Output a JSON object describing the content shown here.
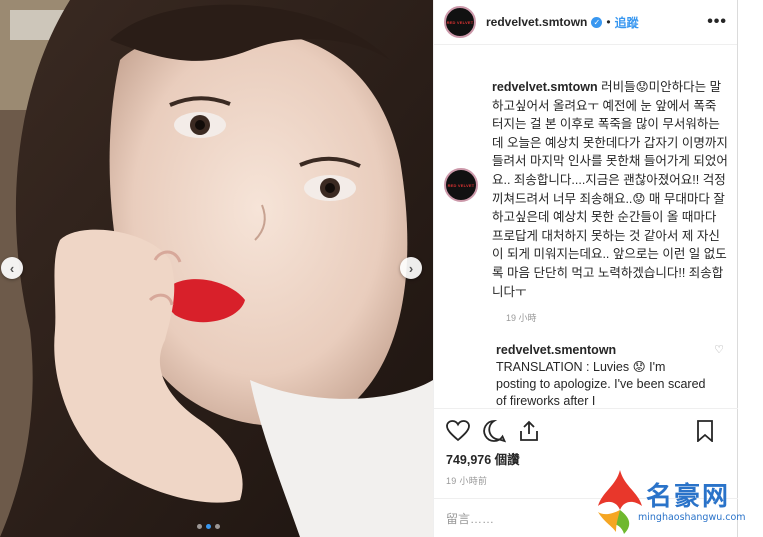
{
  "post": {
    "username": "redvelvet.smtown",
    "follow_label": "追蹤",
    "separator": "•",
    "more": "•••",
    "avatar_text": "RED VELVET"
  },
  "caption": {
    "username": "redvelvet.smtown",
    "text": " 러비들😟미안하다는 말 하고싶어서 올려요ㅜ 예전에 눈 앞에서 폭죽 터지는 걸 본 이후로 폭죽을 많이 무서워하는데 오늘은 예상치 못한데다가 갑자기 이명까지 들려서 마지막 인사를 못한채 들어가게 되었어요.. 죄송합니다....지금은 괜찮아졌어요!! 걱정 끼쳐드려서 너무 죄송해요..😟 매 무대마다 잘하고싶은데 예상치 못한 순간들이 올 때마다 프로답게 대처하지 못하는 것 같아서 제 자신이 되게 미워지는데요.. 앞으로는 이런 일 없도록 마음 단단히 먹고 노력하겠습니다!! 죄송합니다ㅜ",
    "time": "19 小時"
  },
  "reply": {
    "username": "redvelvet.smentown",
    "text": "TRANSLATION : Luvies 😟 I'm posting to apologize. I've been scared of fireworks after I"
  },
  "stats": {
    "likes": "749,976 個讚",
    "time": "19 小時前"
  },
  "comment_input": {
    "placeholder": "留言……"
  },
  "icons": [
    "heart-icon",
    "comment-icon",
    "share-icon",
    "bookmark-icon",
    "verified-badge-icon",
    "carousel-prev-icon",
    "carousel-next-icon"
  ],
  "carousel": {
    "total": 3,
    "active_index": 1
  },
  "watermark": {
    "title": "名豪网",
    "url": "minghaoshangwu.com"
  },
  "colors": {
    "accent": "#3897f0",
    "watermark": "#2a73c9"
  }
}
